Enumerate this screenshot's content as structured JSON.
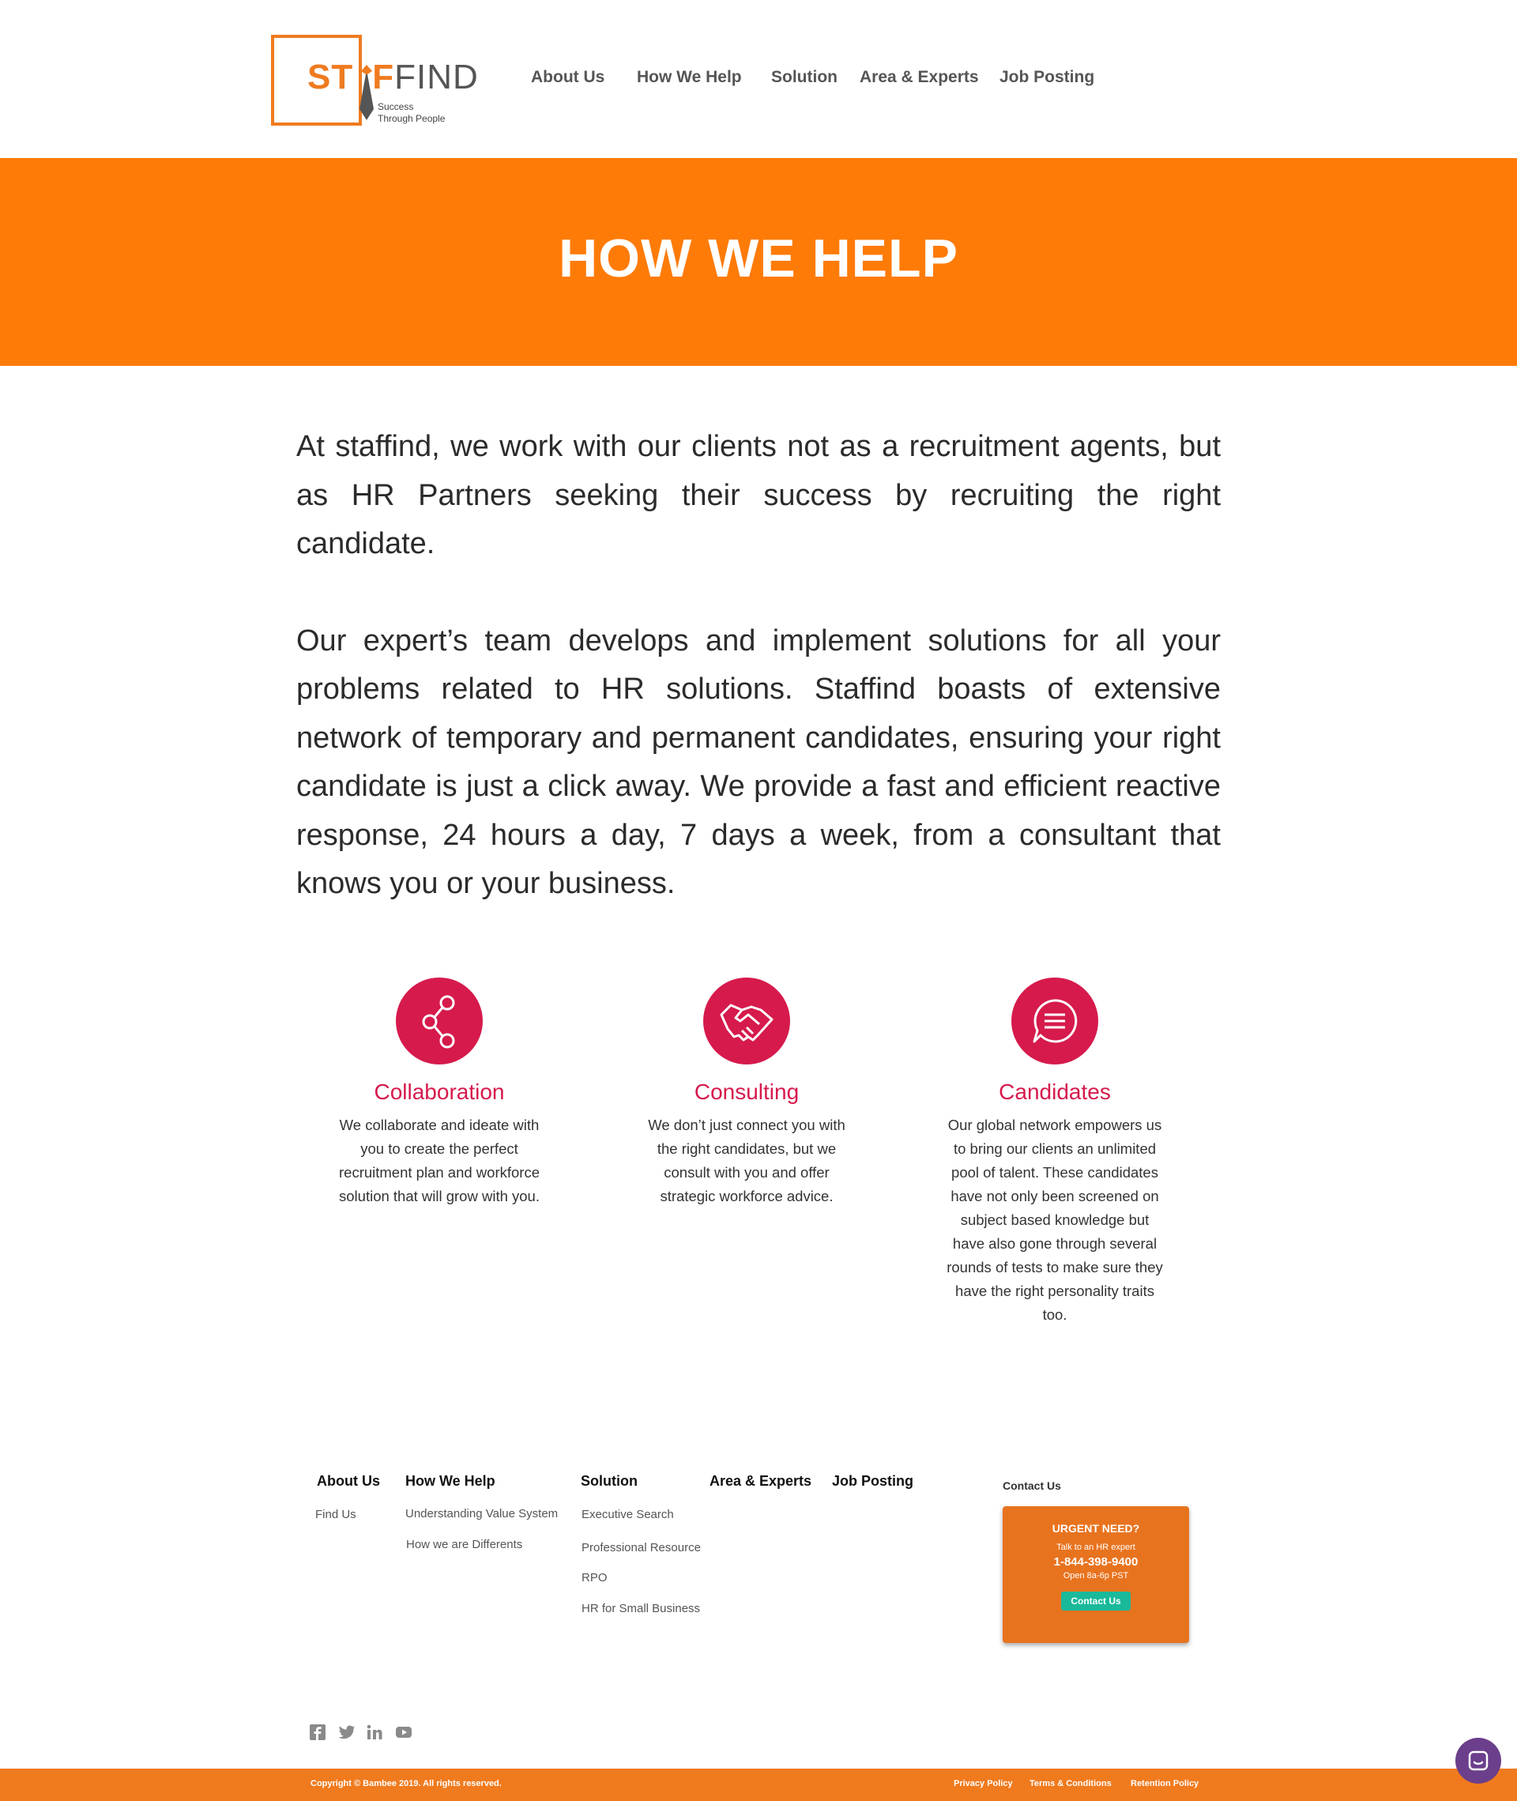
{
  "header": {
    "logo_text_orange_1": "ST",
    "logo_text_orange_2": "F",
    "logo_text_gray": "FIND",
    "logo_tagline_1": "Success",
    "logo_tagline_2": "Through People",
    "nav": [
      "About Us",
      "How We Help",
      "Solution",
      "Area & Experts",
      "Job Posting"
    ]
  },
  "hero": {
    "title": "HOW WE HELP"
  },
  "intro": {
    "paragraph1": "At staffind, we work with our clients not as a recruitment agents, but as HR Partners seeking their success by recruiting the right candidate.",
    "paragraph2": "Our expert’s team develops and implement solutions for all your problems related to HR solutions. Staffind boasts of extensive network of temporary and permanent candidates, ensuring your right candidate is just a click away. We provide a fast and efficient reactive response, 24 hours a day, 7 days a week, from a consultant that knows you or your business."
  },
  "features": [
    {
      "icon": "share-icon",
      "title": "Collaboration",
      "description": "We collaborate and ideate with you to create the perfect recruitment plan and workforce solution that will grow with you."
    },
    {
      "icon": "handshake-icon",
      "title": "Consulting",
      "description": "We don’t just connect you with the right candidates, but we consult with you and offer strategic workforce advice."
    },
    {
      "icon": "chat-bubble-icon",
      "title": "Candidates",
      "description": "Our global network empowers us to bring our clients an unlimited pool of talent. These candidates have not only been screened on subject based knowledge but have also gone through several rounds of tests to make sure they have the right personality traits too."
    }
  ],
  "footer": {
    "columns": [
      {
        "heading": "About Us",
        "links": [
          "Find  Us"
        ]
      },
      {
        "heading": "How We Help",
        "links": [
          "Understanding Value System",
          "How we are Differents"
        ]
      },
      {
        "heading": "Solution",
        "links": [
          "Executive Search",
          "Professional Resource",
          "RPO",
          "HR for Small Business"
        ]
      },
      {
        "heading": "Area & Experts",
        "links": []
      },
      {
        "heading": "Job Posting",
        "links": []
      }
    ],
    "contact": {
      "label": "Contact Us",
      "urgent_title": "URGENT NEED?",
      "urgent_sub": "Talk to an HR expert",
      "phone": "1-844-398-9400",
      "hours": "Open 8a-6p PST",
      "button": "Contact Us"
    },
    "social_icons": [
      "facebook-icon",
      "twitter-icon",
      "linkedin-icon",
      "youtube-icon"
    ],
    "copyright": "Copyright © Bambee 2019. All rights reserved.",
    "legal_links": [
      "Privacy Policy",
      "Terms & Conditions",
      "Retention Policy"
    ]
  },
  "colors": {
    "brand_orange": "#fe7b08",
    "accent_crimson": "#d61a4c",
    "contact_button": "#19b99a",
    "chat_button": "#6b3f8b"
  }
}
